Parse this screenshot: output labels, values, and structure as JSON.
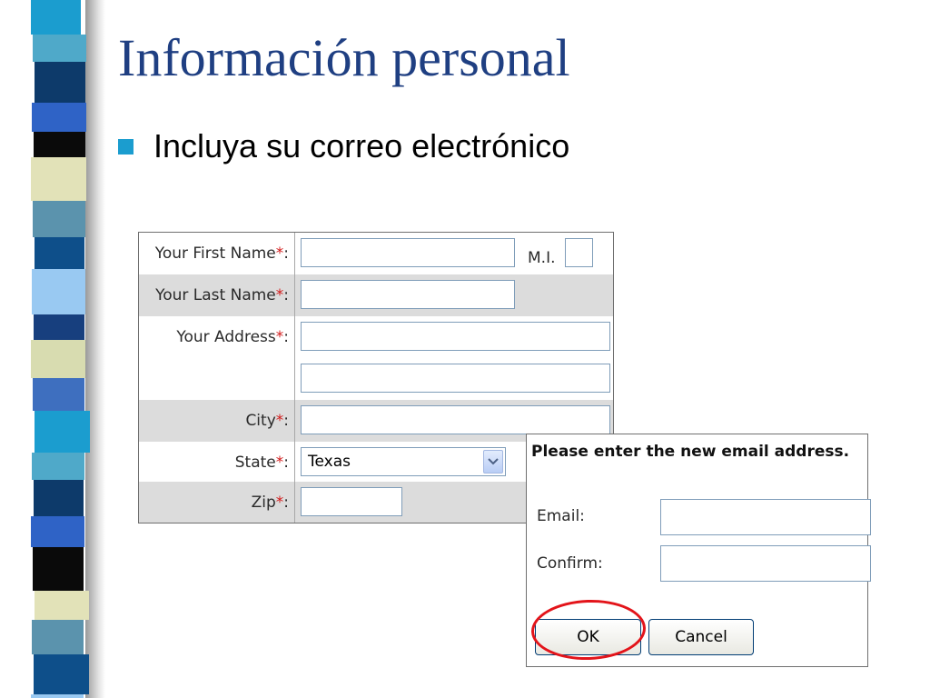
{
  "slide": {
    "title": "Información personal",
    "bullet": "Incluya su correo electrónico"
  },
  "form": {
    "first_name_label": "Your First Name",
    "mi_label": "M.I.",
    "last_name_label": "Your Last Name",
    "address_label": "Your Address",
    "city_label": "City",
    "state_label": "State",
    "state_value": "Texas",
    "zip_label": "Zip",
    "required_mark": "*",
    "colon": ":"
  },
  "dialog": {
    "prompt": "Please enter the new email address.",
    "email_label": "Email:",
    "confirm_label": "Confirm:",
    "ok_label": "OK",
    "cancel_label": "Cancel"
  },
  "colors": {
    "title": "#1f3f82",
    "bullet": "#1b9dcf",
    "required": "#d21a1a",
    "highlight": "#e3141a"
  }
}
